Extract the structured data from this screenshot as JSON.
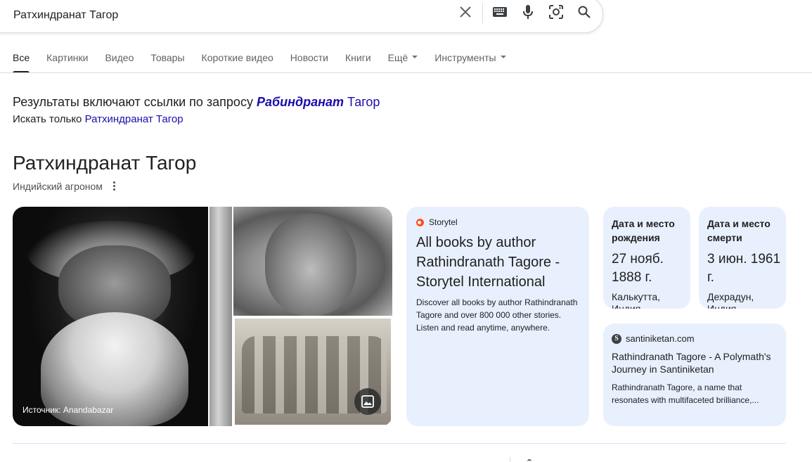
{
  "search": {
    "query": "Ратхиндранат Тагор"
  },
  "tabs": [
    {
      "label": "Все"
    },
    {
      "label": "Картинки"
    },
    {
      "label": "Видео"
    },
    {
      "label": "Товары"
    },
    {
      "label": "Короткие видео"
    },
    {
      "label": "Новости"
    },
    {
      "label": "Книги"
    },
    {
      "label": "Ещё"
    },
    {
      "label": "Инструменты"
    }
  ],
  "spelling": {
    "prefix": "Результаты включают ссылки по запросу",
    "corrected_bold": "Рабиндранат",
    "corrected_rest": "Тагор",
    "only_prefix": "Искать только",
    "only_link": "Ратхиндранат Тагор"
  },
  "entity": {
    "title": "Ратхиндранат Тагор",
    "subtitle": "Индийский агроном",
    "image_source": "Источник: Anandabazar"
  },
  "storytel_card": {
    "source": "Storytel",
    "headline": "All books by author Rathindranath Tagore - Storytel International",
    "snippet": "Discover all books by author Rathindranath Tagore and over 800 000 other stories. Listen and read anytime, anywhere."
  },
  "birth_card": {
    "label": "Дата и место рождения",
    "date": "27 нояб. 1888 г.",
    "place": "Калькутта,",
    "place2": "Индия"
  },
  "death_card": {
    "label": "Дата и место смерти",
    "date": "3 июн. 1961 г.",
    "place": "Дехрадун,",
    "place2": "Индия"
  },
  "santi_card": {
    "source": "santiniketan.com",
    "headline": "Rathindranath Tagore - A Polymath's Journey in Santiniketan",
    "snippet": "Rathindranath Tagore, a name that resonates with multifaceted brilliance,..."
  }
}
